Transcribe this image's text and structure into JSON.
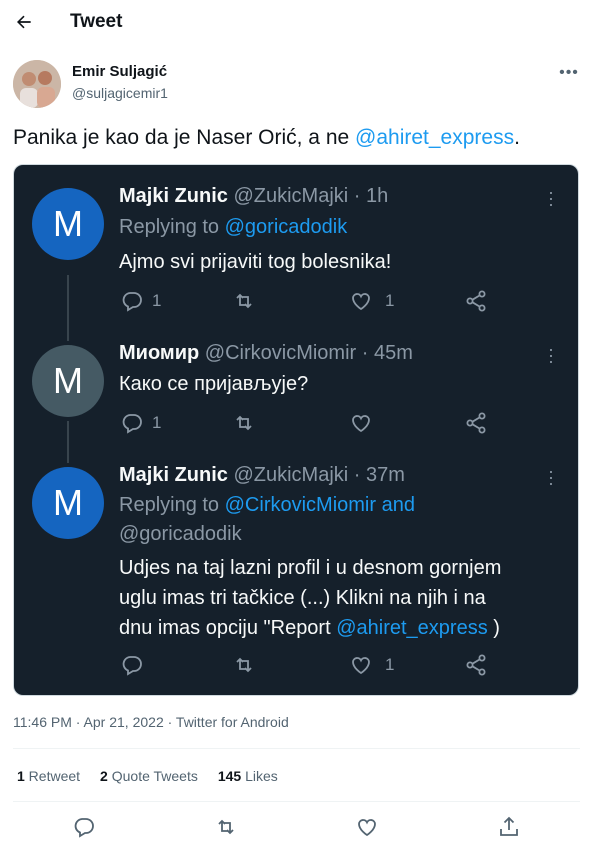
{
  "header": {
    "title": "Tweet"
  },
  "author": {
    "name": "Emir Suljagić",
    "handle": "@suljagicemir1"
  },
  "tweet": {
    "text_before": "Panika je kao da je Naser Orić, a ne ",
    "mention": "@ahiret_express",
    "text_after": "."
  },
  "embedded_thread": [
    {
      "avatar_letter": "M",
      "avatar_color": "#1565c0",
      "name": "Majki Zunic",
      "handle_time": "@ZukicMajki · 1h",
      "replying_prefix": "Replying to ",
      "replying_to": "@goricadodik",
      "text": "Ajmo svi prijaviti tog bolesnika!",
      "reply_count": "1",
      "like_count": "1"
    },
    {
      "avatar_letter": "M",
      "avatar_color": "#455a64",
      "name": "Миомир",
      "handle_time": "@CirkovicMiomir · 45m",
      "text": "Како се пријављује?",
      "reply_count": "1",
      "like_count": ""
    },
    {
      "avatar_letter": "M",
      "avatar_color": "#1565c0",
      "name": "Majki Zunic",
      "handle_time": "@ZukicMajki · 37m",
      "replying_prefix": "Replying to ",
      "replying_to": "@CirkovicMiomir and",
      "replying_to_2": "@goricadodik",
      "text_line1": "Udjes na taj lazni profil i u desnom gornjem",
      "text_line2": "uglu imas tri tačkice (...) Klikni na njih i na",
      "text_line3_prefix": "dnu imas opciju \"Report ",
      "text_line3_mention": "@ahiret_express",
      "text_line3_suffix": " )",
      "reply_count": "",
      "like_count": "1"
    }
  ],
  "meta": {
    "timestamp": "11:46 PM · Apr 21, 2022 · Twitter for Android"
  },
  "stats": {
    "retweets_count": "1",
    "retweets_label": " Retweet",
    "quotes_count": "2",
    "quotes_label": " Quote Tweets",
    "likes_count": "145",
    "likes_label": " Likes"
  },
  "icons": {
    "back": "arrow-left-icon",
    "more": "more-horizontal-icon",
    "reply": "reply-icon",
    "retweet": "retweet-icon",
    "like": "heart-icon",
    "share": "share-icon"
  },
  "colors": {
    "accent": "#1d9bf0",
    "embed_bg": "#15202b"
  }
}
